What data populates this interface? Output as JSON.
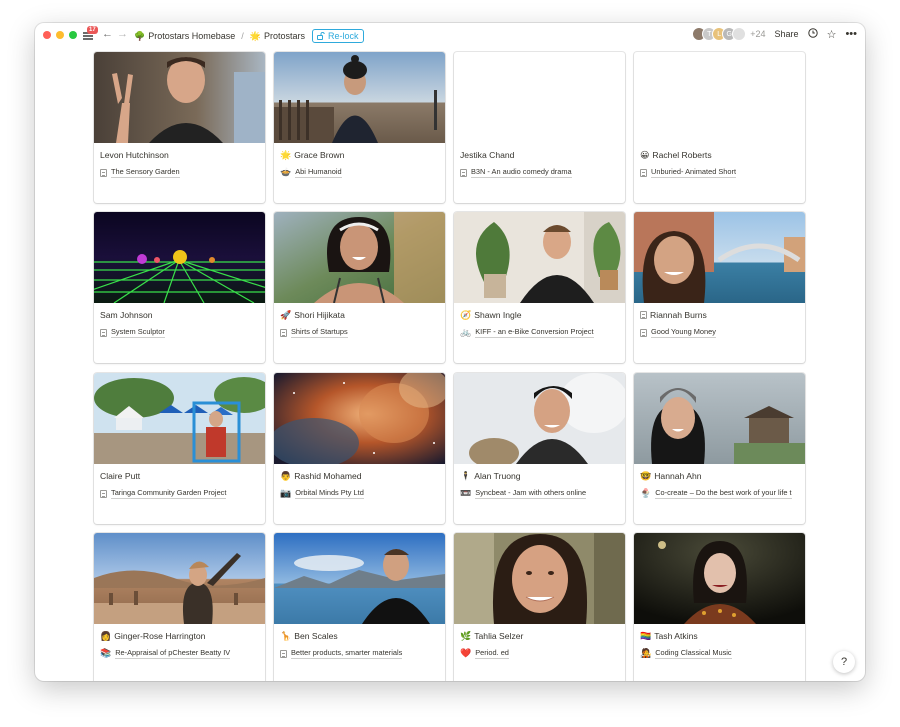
{
  "topbar": {
    "notification_count": "17",
    "breadcrumbs": [
      {
        "emoji": "🌳",
        "label": "Protostars Homebase"
      },
      {
        "emoji": "🌟",
        "label": "Protostars"
      }
    ],
    "relock_label": "Re-lock",
    "avatar_letters": [
      "T",
      "L",
      "G"
    ],
    "more_count": "+24",
    "share_label": "Share"
  },
  "cards": [
    {
      "name": "Levon Hutchinson",
      "name_emoji": "",
      "project": "The Sensory Garden",
      "project_emoji": ""
    },
    {
      "name": "Grace Brown",
      "name_emoji": "🌟",
      "project": "Abi Humanoid",
      "project_emoji": "🍲"
    },
    {
      "name": "Jestika Chand",
      "name_emoji": "",
      "project": "B3N - An audio comedy drama",
      "project_emoji": ""
    },
    {
      "name": "Rachel Roberts",
      "name_emoji": "😀",
      "project": "Unburied- Animated Short",
      "project_emoji": ""
    },
    {
      "name": "Sam Johnson",
      "name_emoji": "",
      "project": "System Sculptor",
      "project_emoji": ""
    },
    {
      "name": "Shori Hijikata",
      "name_emoji": "🚀",
      "project": "Shirts of Startups",
      "project_emoji": ""
    },
    {
      "name": "Shawn Ingle",
      "name_emoji": "🧭",
      "project": "KIFF - an e-Bike Conversion Project",
      "project_emoji": "🚲"
    },
    {
      "name": "Riannah Burns",
      "name_emoji": "",
      "project": "Good Young Money",
      "project_emoji": ""
    },
    {
      "name": "Claire Putt",
      "name_emoji": "",
      "project": "Taringa Community Garden Project",
      "project_emoji": ""
    },
    {
      "name": "Rashid Mohamed",
      "name_emoji": "👨",
      "project": "Orbital Minds Pty Ltd",
      "project_emoji": "📷"
    },
    {
      "name": "Alan Truong",
      "name_emoji": "🕴",
      "project": "Syncbeat - Jam with others online",
      "project_emoji": "📼"
    },
    {
      "name": "Hannah Ahn",
      "name_emoji": "🤓",
      "project": "Co-create – Do the best work of your life t",
      "project_emoji": "🍨"
    },
    {
      "name": "Ginger-Rose Harrington",
      "name_emoji": "👩",
      "project": "Re-Appraisal of pChester Beatty IV",
      "project_emoji": "📚"
    },
    {
      "name": "Ben Scales",
      "name_emoji": "🦒",
      "project": "Better products, smarter materials",
      "project_emoji": ""
    },
    {
      "name": "Tahlia Selzer",
      "name_emoji": "🌿",
      "project": "Period. ed",
      "project_emoji": "❤️"
    },
    {
      "name": "Tash Atkins",
      "name_emoji": "🏳️‍🌈",
      "project": "Coding Classical Music",
      "project_emoji": "🧑‍🎤"
    }
  ],
  "help_label": "?"
}
